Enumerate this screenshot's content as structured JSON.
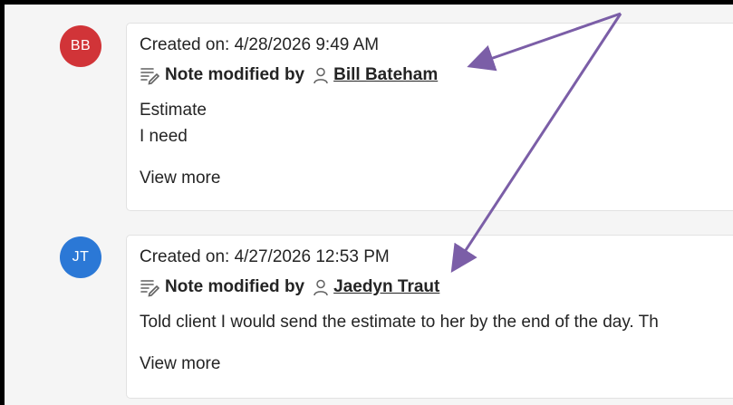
{
  "entries": [
    {
      "avatar_initials": "BB",
      "avatar_color": "#d13438",
      "created": "Created on: 4/28/2026 9:49 AM",
      "title": "Note modified by",
      "author": "Bill Bateham",
      "body_lines": [
        "Estimate",
        "I  need"
      ],
      "view_more": "View more"
    },
    {
      "avatar_initials": "JT",
      "avatar_color": "#2b78d6",
      "created": "Created on: 4/27/2026 12:53 PM",
      "title": "Note modified by",
      "author": "Jaedyn Traut",
      "body_lines": [
        "Told client I would send the estimate to her by the end of the day. Th"
      ],
      "view_more": "View more"
    }
  ],
  "colors": {
    "annotation_arrow": "#7b5ea7",
    "frame_border": "#000000"
  },
  "icons": {
    "note": "note-icon",
    "person": "person-icon"
  }
}
